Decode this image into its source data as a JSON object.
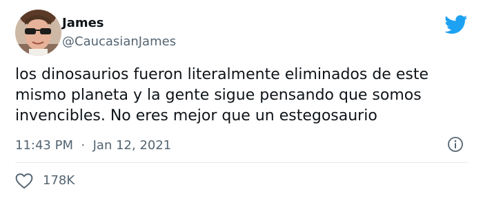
{
  "tweet": {
    "author": {
      "display_name": "James",
      "handle": "@CaucasianJames"
    },
    "text": "los dinosaurios fueron literalmente eliminados de este\nmismo planeta y la gente sigue pensando que somos\ninvencibles. No eres mejor que un estegosaurio",
    "time": "11:43 PM",
    "separator": "·",
    "date": "Jan 12, 2021",
    "likes": "178K"
  },
  "icons": {
    "brand": "twitter-bird-icon",
    "info": "info-icon",
    "like": "heart-icon"
  },
  "colors": {
    "brand": "#1DA1F2",
    "text": "#0f1419",
    "secondary": "#536471",
    "divider": "#e6ecf0"
  }
}
